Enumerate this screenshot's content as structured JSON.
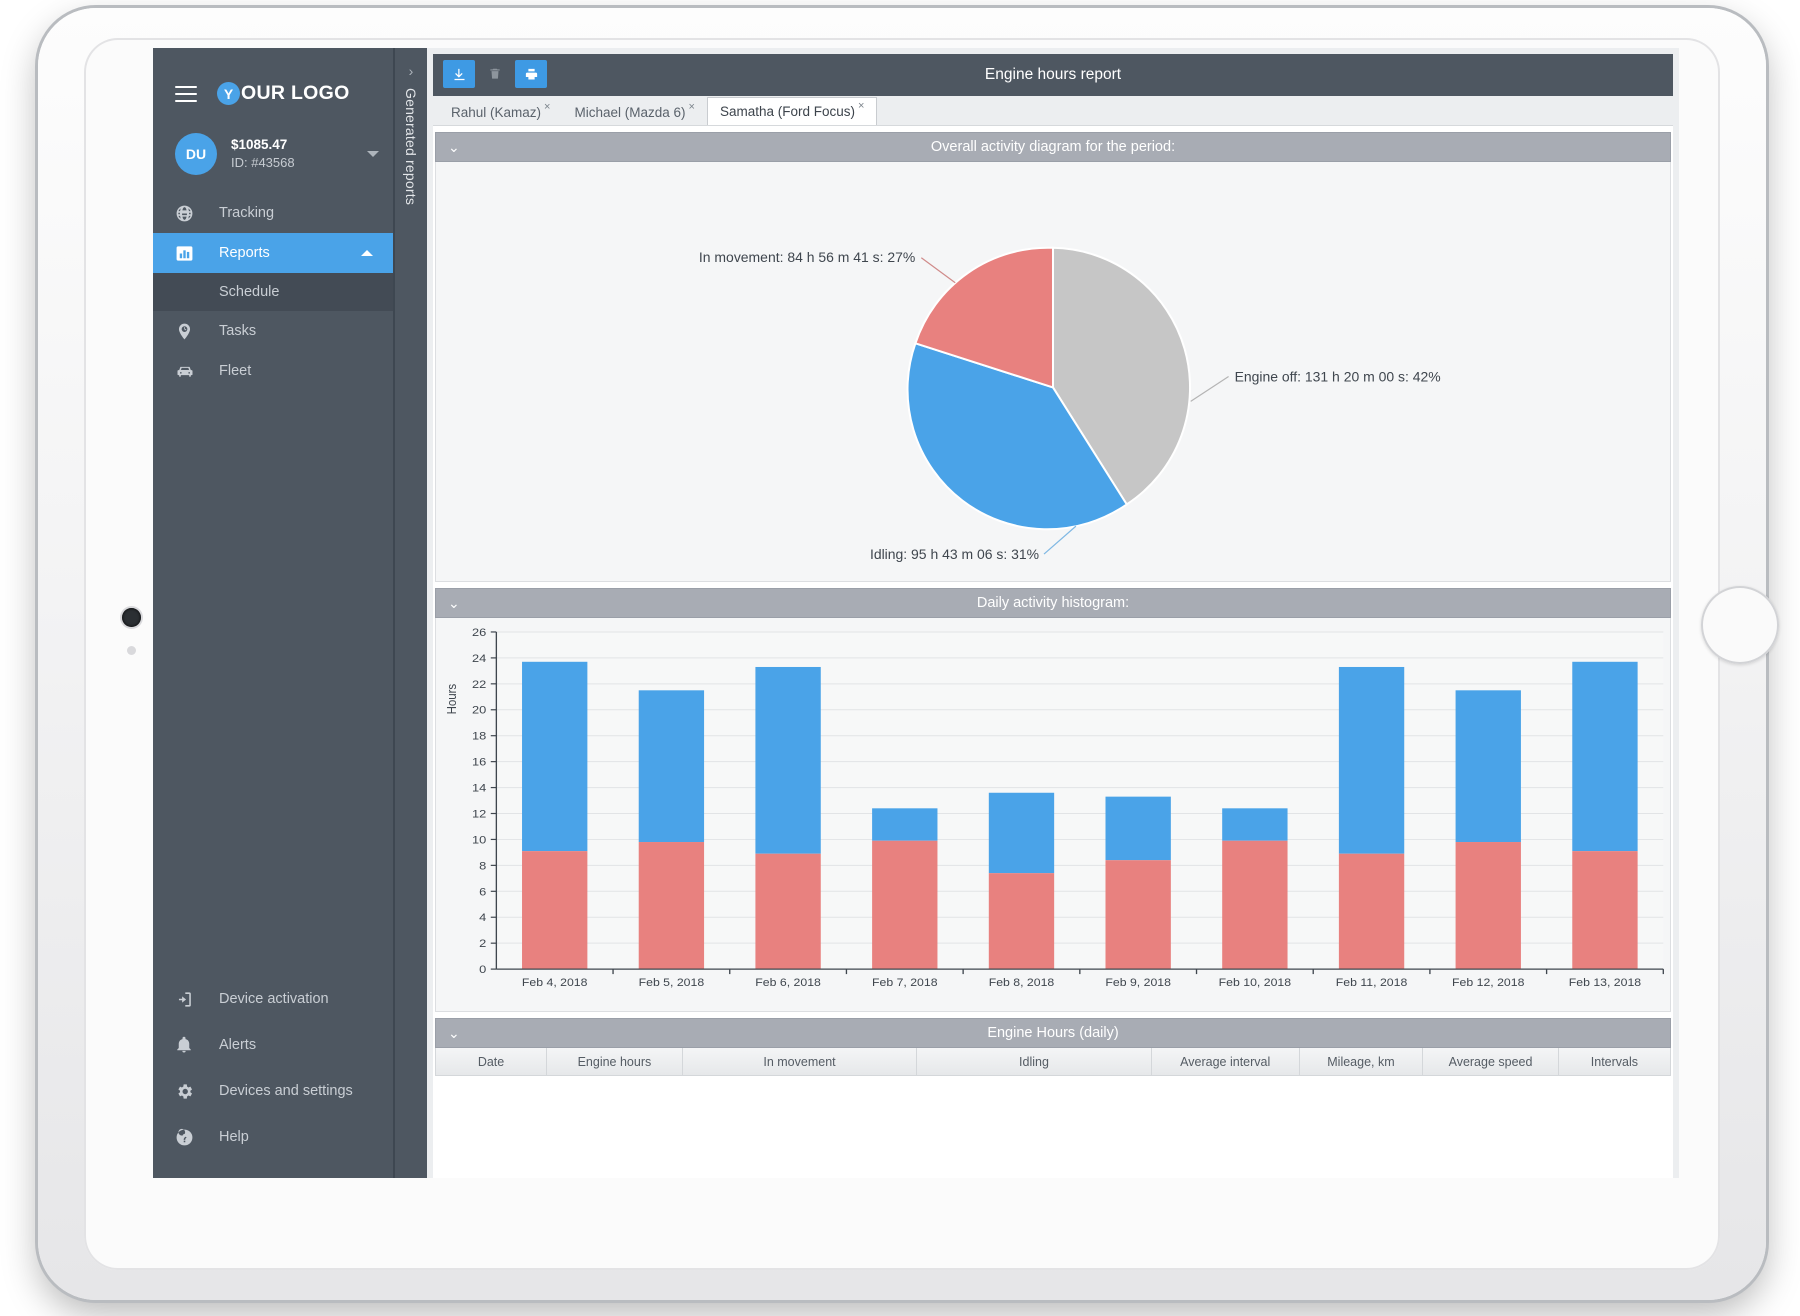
{
  "sidebar": {
    "brand": {
      "badge_letter": "Y",
      "text": "OUR LOGO"
    },
    "account": {
      "initials": "DU",
      "balance": "$1085.47",
      "id": "ID: #43568"
    },
    "items": [
      {
        "label": "Tracking",
        "icon": "globe-icon",
        "active": false
      },
      {
        "label": "Reports",
        "icon": "bar-chart-icon",
        "active": true
      },
      {
        "label": "Tasks",
        "icon": "clock-pin-icon",
        "active": false
      },
      {
        "label": "Fleet",
        "icon": "car-icon",
        "active": false
      }
    ],
    "sub_item": {
      "label": "Schedule"
    },
    "bottom_items": [
      {
        "label": "Device activation",
        "icon": "device-activation-icon"
      },
      {
        "label": "Alerts",
        "icon": "bell-icon"
      },
      {
        "label": "Devices and settings",
        "icon": "gear-icon"
      },
      {
        "label": "Help",
        "icon": "help-icon"
      }
    ]
  },
  "rail": {
    "label": "Generated reports",
    "chevron": "›"
  },
  "header": {
    "title": "Engine hours report"
  },
  "toolbar": {
    "download_label": "download-report",
    "delete_label": "delete-report",
    "print_label": "print-report"
  },
  "tabs": [
    {
      "label": "Rahul (Kamaz)",
      "close": "×",
      "active": false
    },
    {
      "label": "Michael (Mazda 6)",
      "close": "×",
      "active": false
    },
    {
      "label": "Samatha (Ford Focus)",
      "close": "×",
      "active": true
    }
  ],
  "panels": {
    "pie": {
      "title": "Overall activity diagram for the period:",
      "caret": "⌄"
    },
    "hist": {
      "title": "Daily activity histogram:",
      "caret": "⌄"
    },
    "table": {
      "title": "Engine Hours (daily)",
      "caret": "⌄"
    }
  },
  "table": {
    "columns": [
      "Date",
      "Engine hours",
      "In movement",
      "Idling",
      "Average interval",
      "Mileage, km",
      "Average speed",
      "Intervals"
    ],
    "widths": [
      9,
      11,
      19,
      19,
      12,
      10,
      11,
      9
    ]
  },
  "colors": {
    "in_movement": "#e8817f",
    "idling": "#4aa3e8",
    "engine_off": "#c6c6c6",
    "accent": "#4aa3e8",
    "sidebar": "#4e5761",
    "panel_header": "#a8acb4"
  },
  "chart_data": [
    {
      "type": "pie",
      "title": "Overall activity diagram for the period:",
      "labels": [
        "In movement: 84 h 56 m 41 s: 27%",
        "Idling: 95 h 43 m 06 s: 31%",
        "Engine off: 131 h 20 m 00 s: 42%"
      ],
      "slices": [
        {
          "name": "In movement",
          "duration": "84 h 56 m 41 s",
          "percent": 27,
          "color": "#e8817f"
        },
        {
          "name": "Idling",
          "duration": "95 h 43 m 06 s",
          "percent": 31,
          "color": "#4aa3e8"
        },
        {
          "name": "Engine off",
          "duration": "131 h 20 m 00 s",
          "percent": 42,
          "color": "#c6c6c6"
        }
      ],
      "legend": "labels-with-leader-lines"
    },
    {
      "type": "bar",
      "subtype": "stacked",
      "title": "Daily activity histogram:",
      "xlabel": "",
      "ylabel": "Hours",
      "ylim": [
        0,
        26
      ],
      "yticks": [
        0,
        2,
        4,
        6,
        8,
        10,
        12,
        14,
        16,
        18,
        20,
        22,
        24,
        26
      ],
      "grid": true,
      "categories": [
        "Feb 4, 2018",
        "Feb 5, 2018",
        "Feb 6, 2018",
        "Feb 7, 2018",
        "Feb 8, 2018",
        "Feb 9, 2018",
        "Feb 10, 2018",
        "Feb 11, 2018",
        "Feb 12, 2018",
        "Feb 13, 2018"
      ],
      "series": [
        {
          "name": "In movement",
          "color": "#e8817f",
          "values": [
            9.1,
            9.8,
            8.9,
            9.9,
            7.4,
            8.4,
            9.9,
            8.9,
            9.8,
            9.1
          ]
        },
        {
          "name": "Idling",
          "color": "#4aa3e8",
          "values": [
            14.6,
            11.7,
            14.4,
            2.5,
            6.2,
            4.9,
            2.5,
            14.4,
            11.7,
            14.6
          ]
        }
      ],
      "totals": [
        23.7,
        21.5,
        23.3,
        12.4,
        13.6,
        13.3,
        12.4,
        23.3,
        21.5,
        23.7
      ]
    }
  ]
}
